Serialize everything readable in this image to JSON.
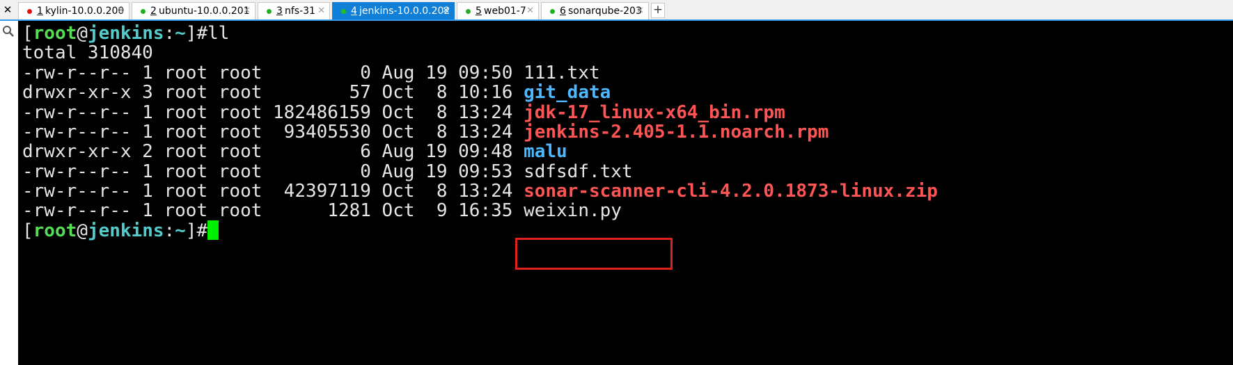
{
  "tabs": [
    {
      "num": "1",
      "label": "kylin-10.0.0.200",
      "dot_color": "#e01010",
      "active": false
    },
    {
      "num": "2",
      "label": "ubuntu-10.0.0.201",
      "dot_color": "#20b020",
      "active": false
    },
    {
      "num": "3",
      "label": "nfs-31",
      "dot_color": "#20b020",
      "active": false
    },
    {
      "num": "4",
      "label": "jenkins-10.0.0.202",
      "dot_color": "#20c020",
      "active": true
    },
    {
      "num": "5",
      "label": "web01-7",
      "dot_color": "#20b020",
      "active": false
    },
    {
      "num": "6",
      "label": "sonarqube-203",
      "dot_color": "#20b020",
      "active": false
    }
  ],
  "tab_close_glyph": "✕",
  "close_all_glyph": "✕",
  "new_tab_glyph": "+",
  "icons": {
    "close_all": "close-icon",
    "new_tab": "plus-icon",
    "search": "search-icon"
  },
  "terminal": {
    "prompt1": {
      "lb": "[",
      "user": "root",
      "at": "@",
      "host": "jenkins",
      "colon": ":",
      "path": "~",
      "rb": "]#",
      "cmd": "ll"
    },
    "total": "total 310840",
    "entries": [
      {
        "meta": "-rw-r--r-- 1 root root         0 Aug 19 09:50 ",
        "name": "111.txt",
        "kind": "file"
      },
      {
        "meta": "drwxr-xr-x 3 root root        57 Oct  8 10:16 ",
        "name": "git_data",
        "kind": "dir"
      },
      {
        "meta": "-rw-r--r-- 1 root root 182486159 Oct  8 13:24 ",
        "name": "jdk-17_linux-x64_bin.rpm",
        "kind": "archive"
      },
      {
        "meta": "-rw-r--r-- 1 root root  93405530 Oct  8 13:24 ",
        "name": "jenkins-2.405-1.1.noarch.rpm",
        "kind": "archive"
      },
      {
        "meta": "drwxr-xr-x 2 root root         6 Aug 19 09:48 ",
        "name": "malu",
        "kind": "dir"
      },
      {
        "meta": "-rw-r--r-- 1 root root         0 Aug 19 09:53 ",
        "name": "sdfsdf.txt",
        "kind": "file"
      },
      {
        "meta": "-rw-r--r-- 1 root root  42397119 Oct  8 13:24 ",
        "name": "sonar-scanner-cli-4.2.0.1873-linux.zip",
        "kind": "archive"
      },
      {
        "meta": "-rw-r--r-- 1 root root      1281 Oct  9 16:35 ",
        "name": "weixin.py",
        "kind": "file"
      }
    ],
    "prompt2": {
      "lb": "[",
      "user": "root",
      "at": "@",
      "host": "jenkins",
      "colon": ":",
      "path": "~",
      "rb": "]#",
      "cmd": ""
    },
    "colors": {
      "background": "#000000",
      "user": "#55dd55",
      "host": "#55cccc",
      "dir": "#4db8ff",
      "archive": "#ff5555",
      "cursor": "#00ee00",
      "highlight_box": "#e0201a"
    }
  }
}
